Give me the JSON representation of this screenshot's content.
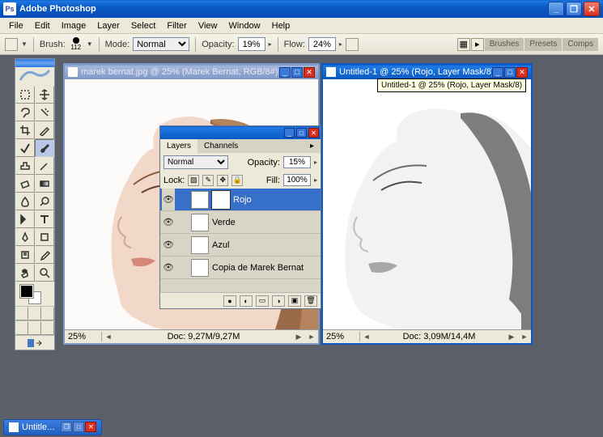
{
  "app_title": "Adobe Photoshop",
  "app_icon_letter": "Ps",
  "menu": [
    "File",
    "Edit",
    "Image",
    "Layer",
    "Select",
    "Filter",
    "View",
    "Window",
    "Help"
  ],
  "options": {
    "brush_label": "Brush:",
    "brush_size": "112",
    "mode_label": "Mode:",
    "mode_value": "Normal",
    "opacity_label": "Opacity:",
    "opacity_value": "19%",
    "flow_label": "Flow:",
    "flow_value": "24%"
  },
  "palette_dock": [
    "Brushes",
    "Presets",
    "Comps"
  ],
  "doc1": {
    "title": "marek bernat.jpg @ 25% (Marek Bernat, RGB/8#)",
    "zoom": "25%",
    "status": "Doc: 9,27M/9,27M"
  },
  "doc2": {
    "title": "Untitled-1 @ 25% (Rojo, Layer Mask/8)",
    "zoom": "25%",
    "status": "Doc: 3,09M/14,4M",
    "tooltip": "Untitled-1 @ 25% (Rojo, Layer Mask/8)"
  },
  "layers_panel": {
    "tabs": [
      "Layers",
      "Channels"
    ],
    "blend_mode": "Normal",
    "opacity_label": "Opacity:",
    "opacity": "15%",
    "lock_label": "Lock:",
    "fill_label": "Fill:",
    "fill": "100%",
    "layers": [
      {
        "name": "Rojo",
        "selected": true,
        "has_mask": true
      },
      {
        "name": "Verde",
        "selected": false,
        "has_mask": false
      },
      {
        "name": "Azul",
        "selected": false,
        "has_mask": false
      },
      {
        "name": "Copia de Marek Bernat",
        "selected": false,
        "has_mask": false
      }
    ]
  },
  "taskbar": {
    "item": "Untitle..."
  }
}
